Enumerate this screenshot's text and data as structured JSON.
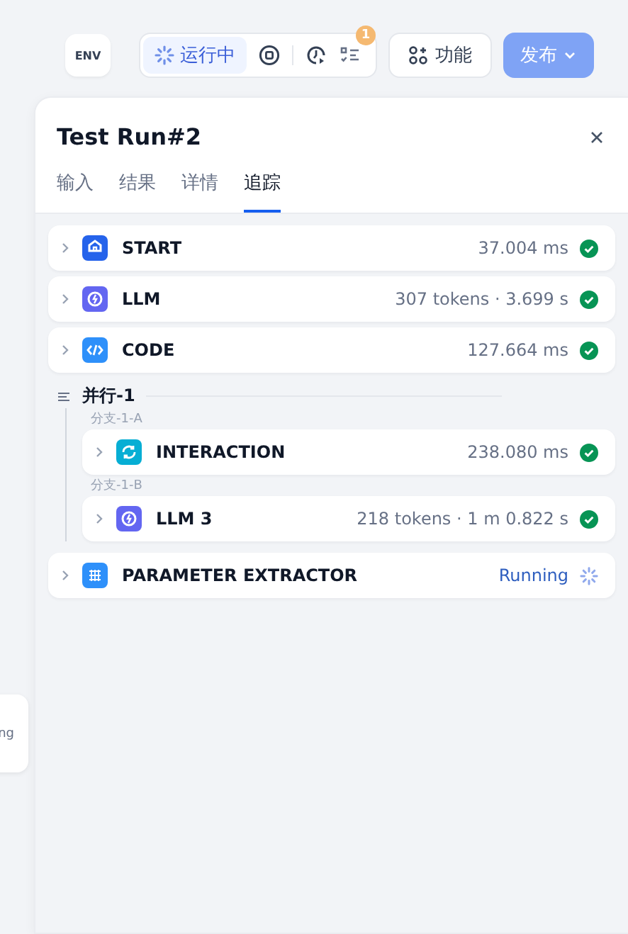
{
  "toolbar": {
    "env": "ENV",
    "run_status": "运行中",
    "badge": "1",
    "features": "功能",
    "publish": {
      "label": "发布",
      "disabled": true
    }
  },
  "side_card": {
    "text": "ng"
  },
  "panel": {
    "title": "Test Run#2",
    "tabs": [
      {
        "label": "输入",
        "selected": false
      },
      {
        "label": "结果",
        "selected": false
      },
      {
        "label": "详情",
        "selected": false
      },
      {
        "label": "追踪",
        "selected": true
      }
    ],
    "trace": [
      {
        "kind": "start",
        "color": "#2563eb",
        "name": "START",
        "meta": "37.004 ms",
        "done": true
      },
      {
        "kind": "llm",
        "color": "#6366f1",
        "name": "LLM",
        "meta": "307 tokens · 3.699 s",
        "done": true
      },
      {
        "kind": "code",
        "color": "#2e90fa",
        "name": "CODE",
        "meta": "127.664 ms",
        "done": true
      },
      {
        "kind": "parallel",
        "title": "并行-1",
        "branches": [
          {
            "label": "分支-1-A",
            "nodes": [
              {
                "kind": "interaction",
                "color": "#06aed4",
                "name": "INTERACTION",
                "meta": "238.080 ms",
                "done": true
              }
            ]
          },
          {
            "label": "分支-1-B",
            "nodes": [
              {
                "kind": "llm",
                "color": "#6366f1",
                "name": "LLM 3",
                "meta": "218 tokens · 1 m 0.822 s",
                "done": true
              }
            ]
          }
        ]
      },
      {
        "kind": "extractor",
        "color": "#2e90fa",
        "name": "PARAMETER EXTRACTOR",
        "meta": "Running",
        "done": false
      }
    ]
  }
}
